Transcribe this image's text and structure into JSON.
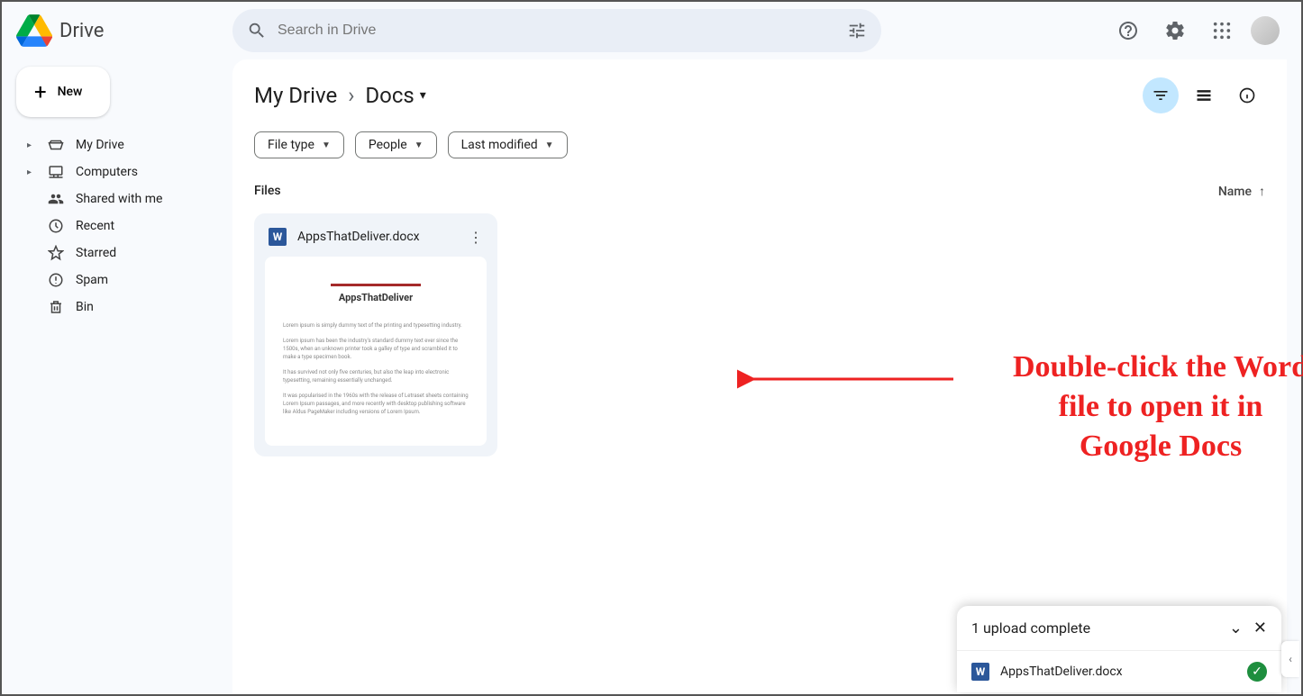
{
  "app": {
    "title": "Drive"
  },
  "search": {
    "placeholder": "Search in Drive"
  },
  "newButton": {
    "label": "New"
  },
  "nav": {
    "myDrive": "My Drive",
    "computers": "Computers",
    "shared": "Shared with me",
    "recent": "Recent",
    "starred": "Starred",
    "spam": "Spam",
    "bin": "Bin"
  },
  "breadcrumb": {
    "root": "My Drive",
    "current": "Docs"
  },
  "filters": {
    "filetype": "File type",
    "people": "People",
    "modified": "Last modified"
  },
  "section": {
    "files": "Files",
    "sort": "Name"
  },
  "file": {
    "name": "AppsThatDeliver.docx",
    "thumbTitle": "AppsThatDeliver",
    "lorem1": "Lorem ipsum is simply dummy text of the printing and typesetting industry.",
    "lorem2": "Lorem ipsum has been the industry's standard dummy text ever since the 1500s, when an unknown printer took a galley of type and scrambled it to make a type specimen book.",
    "lorem3": "It has survived not only five centuries, but also the leap into electronic typesetting, remaining essentially unchanged.",
    "lorem4": "It was popularised in the 1960s with the release of Letraset sheets containing Lorem Ipsum passages, and more recently with desktop publishing software like Aldus PageMaker including versions of Lorem Ipsum."
  },
  "annotation": {
    "line1": "Double-click the Word",
    "line2": "file to open it in",
    "line3": "Google Docs"
  },
  "toast": {
    "title": "1 upload complete",
    "file": "AppsThatDeliver.docx"
  }
}
